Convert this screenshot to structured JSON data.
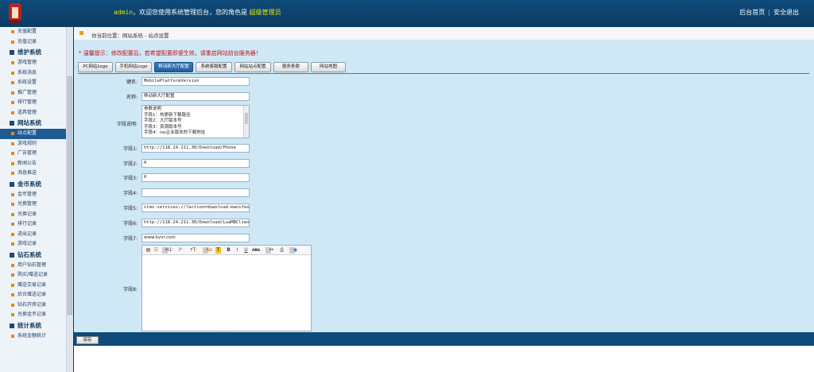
{
  "header": {
    "user": "admin",
    "welcome_text": "，欢迎您使用系统管理后台，您的角色是",
    "role": "超级管理员",
    "link_home": "后台首页",
    "link_sep": "|",
    "link_logout": "安全退出"
  },
  "sidebar": {
    "items": [
      {
        "type": "item",
        "label": "充值配置"
      },
      {
        "type": "item",
        "label": "充值记录"
      },
      {
        "type": "group",
        "label": "维护系统"
      },
      {
        "type": "item",
        "label": "游戏管理"
      },
      {
        "type": "item",
        "label": "系统消息"
      },
      {
        "type": "item",
        "label": "系统设置"
      },
      {
        "type": "item",
        "label": "推广管理"
      },
      {
        "type": "item",
        "label": "排行管理"
      },
      {
        "type": "item",
        "label": "道具管理"
      },
      {
        "type": "group",
        "label": "网站系统"
      },
      {
        "type": "item",
        "label": "站点配置",
        "active": true
      },
      {
        "type": "item",
        "label": "游戏规则"
      },
      {
        "type": "item",
        "label": "广告管理"
      },
      {
        "type": "item",
        "label": "新闻公告"
      },
      {
        "type": "item",
        "label": "消息推送"
      },
      {
        "type": "group",
        "label": "金币系统"
      },
      {
        "type": "item",
        "label": "金币管理"
      },
      {
        "type": "item",
        "label": "兑换管理"
      },
      {
        "type": "item",
        "label": "兑换记录"
      },
      {
        "type": "item",
        "label": "排行记录"
      },
      {
        "type": "item",
        "label": "进出记录"
      },
      {
        "type": "item",
        "label": "游戏记录"
      },
      {
        "type": "group",
        "label": "钻石系统"
      },
      {
        "type": "item",
        "label": "用户钻石管理"
      },
      {
        "type": "item",
        "label": "购买/赠送记录"
      },
      {
        "type": "item",
        "label": "赠送交易记录"
      },
      {
        "type": "item",
        "label": "后台赠送记录"
      },
      {
        "type": "item",
        "label": "钻石开房记录"
      },
      {
        "type": "item",
        "label": "兑换金币记录"
      },
      {
        "type": "group",
        "label": "统计系统"
      },
      {
        "type": "item",
        "label": "系统金额统计"
      }
    ]
  },
  "breadcrumb": "你当前位置：网站系统 - 站点设置",
  "tip": "* 温馨提示：修改配置后，若希望配置即便生效，请重启网站前台服务器！",
  "tabs": [
    {
      "label": "PC网站Logo"
    },
    {
      "label": "手机网站Logo"
    },
    {
      "label": "移动新大厅配置",
      "active": true
    },
    {
      "label": "系统客服配置"
    },
    {
      "label": "网站站点配置"
    },
    {
      "label": "服务条款"
    },
    {
      "label": "网站地图"
    }
  ],
  "form": {
    "key_label": "键名:",
    "key_value": "MobilePlatformVersion",
    "name_label": "名称:",
    "name_value": "移动新大厅配置",
    "desc_label": "字段说明:",
    "desc_lines": [
      "参数说明",
      "字段1：热更新下载路径",
      "字段2：大厅版本号",
      "字段3：资源版本号",
      "字段4：ios企业版本的下载地址"
    ],
    "f1_label": "字段1:",
    "f1_value": "http://118.24.211.30/Download/Phone",
    "f2_label": "字段2:",
    "f2_value": "0",
    "f3_label": "字段3:",
    "f3_value": "0",
    "f4_label": "字段4:",
    "f4_value": "",
    "f5_label": "字段5:",
    "f5_value": "itms-services://?action=download-manifest&",
    "f6_label": "字段6:",
    "f6_value": "http://118.24.211.30/Download/LuaMBClient_",
    "f7_label": "字段7:",
    "f7_value": "www.kvvr.com",
    "f8_label": "字段8:"
  },
  "editor_toolbar": [
    "H1·",
    "ℱ·",
    "ᴛT·",
    "Ab",
    "T",
    "B",
    "I",
    "U",
    "ABC"
  ],
  "save_label": "保存"
}
